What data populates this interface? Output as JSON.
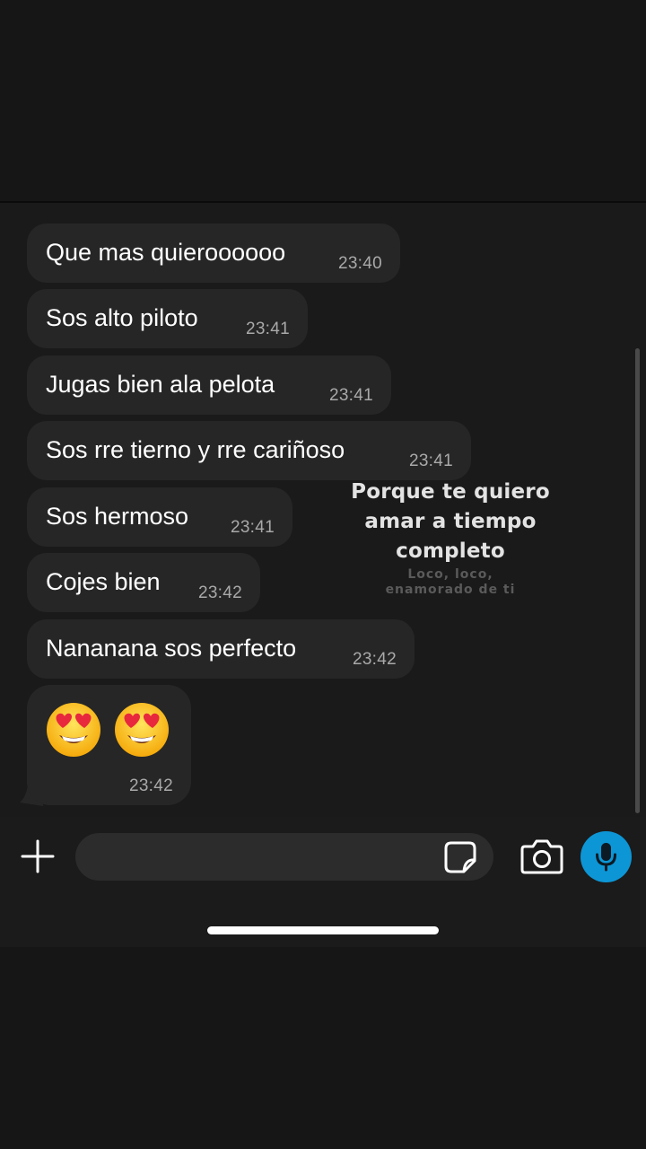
{
  "messages": [
    {
      "text": "Que mas quieroooooo",
      "time": "23:40"
    },
    {
      "text": "Sos alto piloto",
      "time": "23:41"
    },
    {
      "text": "Jugas bien ala pelota",
      "time": "23:41"
    },
    {
      "text": "Sos rre tierno y rre cariñoso",
      "time": "23:41"
    },
    {
      "text": "Sos hermoso",
      "time": "23:41"
    },
    {
      "text": "Cojes bien",
      "time": "23:42"
    },
    {
      "text": "Nananana sos perfecto",
      "time": "23:42"
    }
  ],
  "emoji_message": {
    "emojis": [
      "heart-eyes",
      "heart-eyes"
    ],
    "time": "23:42"
  },
  "overlay": {
    "line1": "Porque te quiero",
    "line2": "amar a tiempo",
    "line3": "completo",
    "sub1": "Loco, loco,",
    "sub2": "enamorado de ti"
  },
  "composer": {
    "value": ""
  },
  "icons": {
    "add": "plus-icon",
    "sticker": "sticker-icon",
    "camera": "camera-icon",
    "mic": "microphone-icon"
  },
  "colors": {
    "accent": "#0d96d6",
    "bubble": "#262626",
    "background": "#1a1a1a"
  }
}
